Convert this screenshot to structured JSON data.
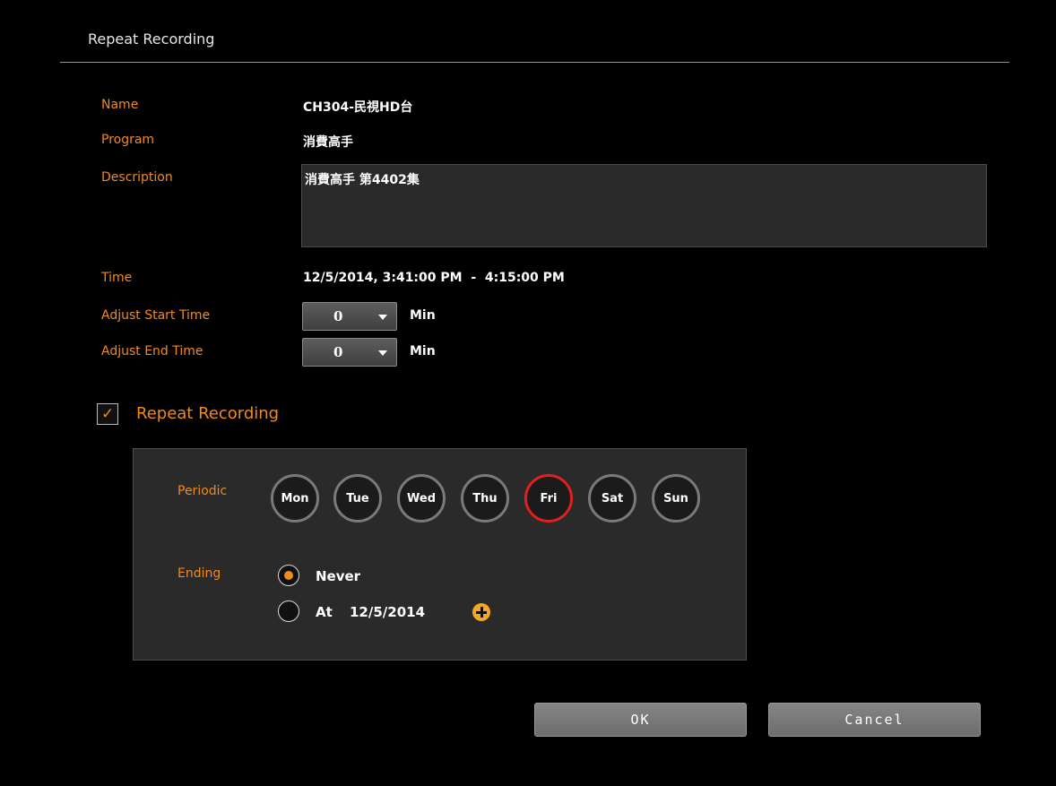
{
  "dialog": {
    "title": "Repeat Recording"
  },
  "fields": {
    "name_label": "Name",
    "name_value": "CH304-民視HD台",
    "program_label": "Program",
    "program_value": "消費高手",
    "description_label": "Description",
    "description_value": "消費高手 第4402集",
    "time_label": "Time",
    "time_value": "12/5/2014, 3:41:00 PM  -  4:15:00 PM",
    "adjust_start_label": "Adjust Start Time",
    "adjust_start_value": "0",
    "adjust_end_label": "Adjust End Time",
    "adjust_end_value": "0",
    "unit": "Min"
  },
  "repeat": {
    "checked": true,
    "label": "Repeat Recording",
    "periodic_label": "Periodic",
    "days": [
      {
        "label": "Mon",
        "selected": false
      },
      {
        "label": "Tue",
        "selected": false
      },
      {
        "label": "Wed",
        "selected": false
      },
      {
        "label": "Thu",
        "selected": false
      },
      {
        "label": "Fri",
        "selected": true
      },
      {
        "label": "Sat",
        "selected": false
      },
      {
        "label": "Sun",
        "selected": false
      }
    ],
    "ending_label": "Ending",
    "never_label": "Never",
    "never_selected": true,
    "at_label": "At",
    "at_date": "12/5/2014"
  },
  "buttons": {
    "ok": "OK",
    "cancel": "Cancel"
  },
  "colors": {
    "accent": "#f28a1e",
    "selected_day_ring": "#e02020",
    "background": "#000000"
  }
}
